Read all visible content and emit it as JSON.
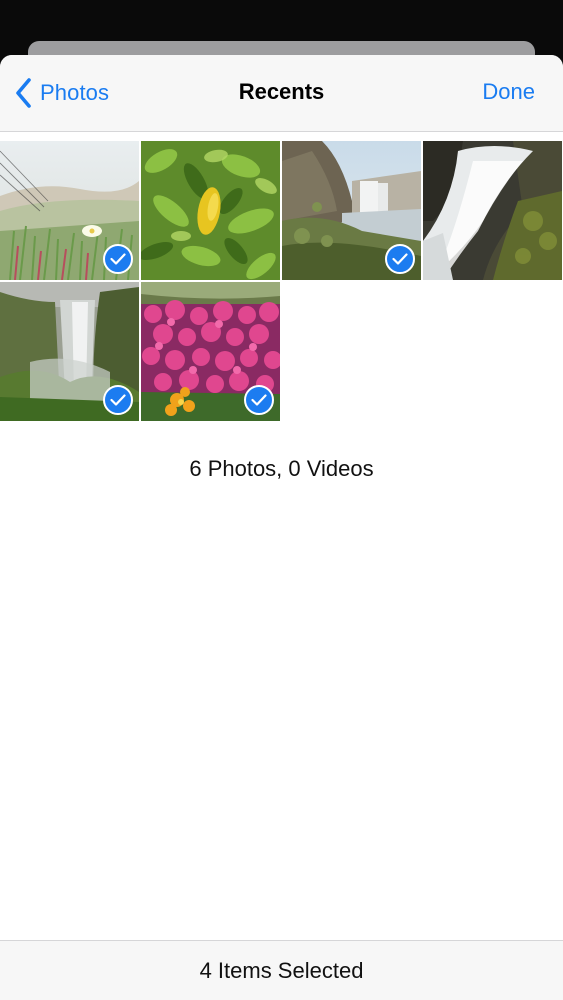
{
  "colors": {
    "accent": "#1a7cf1",
    "selection_badge": "#1c7cf0"
  },
  "navbar": {
    "back_label": "Photos",
    "title": "Recents",
    "done_label": "Done",
    "back_icon": "chevron-left-icon"
  },
  "photos": [
    {
      "subject": "coastal-plants-with-flower",
      "selected": true
    },
    {
      "subject": "lemon-tree-leaves",
      "selected": false
    },
    {
      "subject": "waterfall-cliff-valley",
      "selected": true
    },
    {
      "subject": "waterfall-rocks-long-exposure",
      "selected": false
    },
    {
      "subject": "misty-waterfall",
      "selected": true
    },
    {
      "subject": "pink-and-orange-flowers",
      "selected": true
    }
  ],
  "summary": "6 Photos, 0 Videos",
  "toolbar": {
    "selection_text": "4 Items Selected"
  },
  "check_icon": "checkmark-icon"
}
